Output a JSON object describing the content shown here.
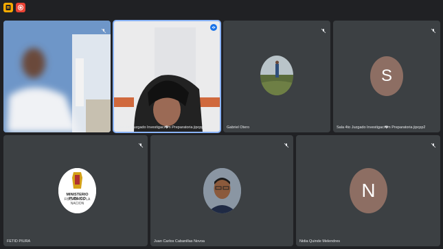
{
  "app": {
    "top_icons": [
      "slides-icon",
      "record-icon"
    ],
    "colors": {
      "background": "#202124",
      "tile": "#3c4043",
      "active_outline": "#8ab4f8",
      "avatar_letter_bg": "#8d6e63"
    }
  },
  "participants": [
    {
      "name": "",
      "muted": true,
      "video": "blurred-person"
    },
    {
      "name": "Sala 4to Juzgado Investigaci�n Preparatoria jipcpp2",
      "muted": false,
      "speaking": true,
      "video": "camera"
    },
    {
      "name": "Gabriel Otero",
      "muted": true,
      "avatar": "photo"
    },
    {
      "name": "Sala 4to Juzgado Investigaci�n Preparatoria jipcpp2",
      "muted": true,
      "avatar_letter": "S"
    },
    {
      "name": "FETID PIURA",
      "muted": true,
      "avatar": "logo",
      "logo_text": [
        "MINISTERIO PUBLICO",
        "FISCALIA DE LA NACION"
      ]
    },
    {
      "name": "Juan Carlos Cabanillas Novoa",
      "muted": true,
      "avatar": "photo"
    },
    {
      "name": "Nidia Quinde Melendres",
      "muted": true,
      "avatar_letter": "N"
    }
  ]
}
